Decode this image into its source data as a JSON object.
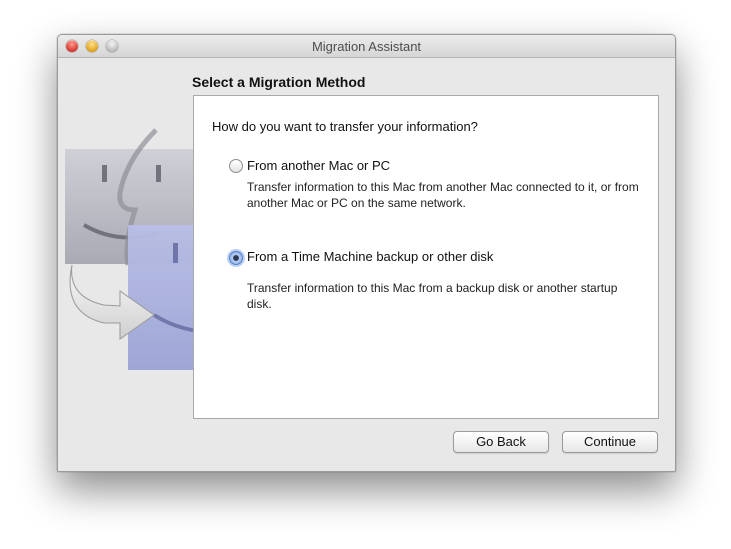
{
  "window": {
    "title": "Migration Assistant"
  },
  "page": {
    "heading": "Select a Migration Method",
    "question": "How do you want to transfer your information?"
  },
  "options": [
    {
      "label": "From another Mac or PC",
      "description": "Transfer information to this Mac from another Mac connected to it, or from another Mac or PC on the same network.",
      "selected": false
    },
    {
      "label": "From a Time Machine backup or other disk",
      "description": "Transfer information to this Mac from a backup disk or another startup disk.",
      "selected": true
    }
  ],
  "buttons": {
    "back_label": "Go Back",
    "continue_label": "Continue"
  },
  "icons": {
    "close": "close-button",
    "minimize": "minimize-button",
    "zoom": "zoom-button",
    "artwork": "finder-migration-icon"
  },
  "colors": {
    "accent": "#4e7cc7",
    "window_bg": "#e8e8e8"
  }
}
